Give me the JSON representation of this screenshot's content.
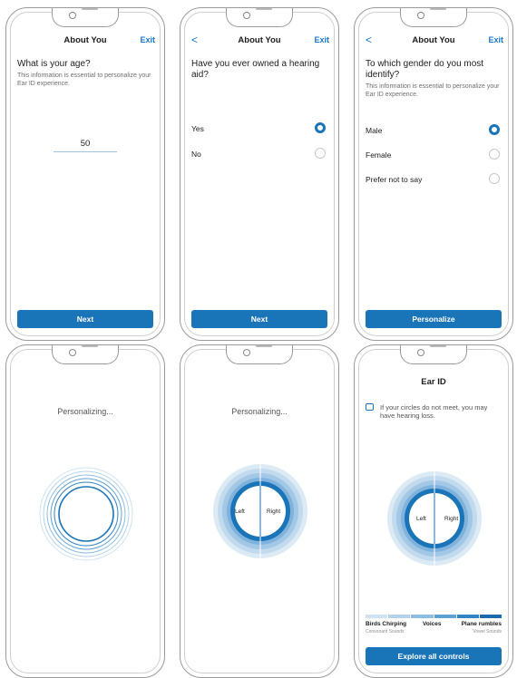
{
  "colors": {
    "accent": "#1a74b8",
    "ring_light": "#9cc8e8",
    "ring_mid": "#3d8fcb",
    "ring_dark": "#1a74b8"
  },
  "screen1": {
    "title": "About You",
    "exit": "Exit",
    "question": "What is your age?",
    "subtitle": "This information is essential to personalize your Ear ID experience.",
    "age_value": "50",
    "cta": "Next"
  },
  "screen2": {
    "back": "<",
    "title": "About You",
    "exit": "Exit",
    "question": "Have you ever owned a hearing aid?",
    "options": [
      {
        "label": "Yes",
        "selected": true
      },
      {
        "label": "No",
        "selected": false
      }
    ],
    "cta": "Next"
  },
  "screen3": {
    "back": "<",
    "title": "About You",
    "exit": "Exit",
    "question": "To which gender do you most identify?",
    "subtitle": "This information is essential to personalize your Ear ID experience.",
    "options": [
      {
        "label": "Male",
        "selected": true
      },
      {
        "label": "Female",
        "selected": false
      },
      {
        "label": "Prefer not to say",
        "selected": false
      }
    ],
    "cta": "Personalize"
  },
  "screen4": {
    "status": "Personalizing..."
  },
  "screen5": {
    "status": "Personalizing...",
    "left": "Left",
    "right": "Right"
  },
  "screen6": {
    "title": "Ear ID",
    "info": "If your circles do not meet, you may have hearing loss.",
    "left": "Left",
    "right": "Right",
    "scale_colors": [
      "#cfe3f2",
      "#b4d3ea",
      "#8dbde0",
      "#5fa1d3",
      "#3583c4",
      "#1a6aad"
    ],
    "scale": [
      {
        "label": "Birds Chirping",
        "sub": "Consonant Sounds"
      },
      {
        "label": "Voices",
        "sub": ""
      },
      {
        "label": "Plane rumbles",
        "sub": "Vowel Sounds"
      }
    ],
    "cta": "Explore all controls"
  },
  "icons": [
    "info-icon",
    "back-chevron-icon",
    "radio-icon"
  ]
}
